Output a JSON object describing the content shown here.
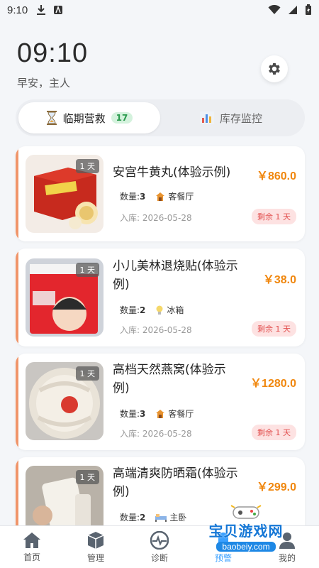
{
  "status_bar": {
    "time": "9:10"
  },
  "header": {
    "clock": "09:10",
    "greeting": "早安，主人"
  },
  "tabs": [
    {
      "label": "临期营救",
      "count": "17"
    },
    {
      "label": "库存监控"
    }
  ],
  "items": [
    {
      "name": "安宫牛黄丸(体验示例)",
      "price": "￥860.0",
      "qty_label": "数量:",
      "qty": "3",
      "location": "客餐厅",
      "location_icon": "house-icon",
      "date": "入库: 2026-05-28",
      "days": "1 天",
      "remaining": "剩余 1 天"
    },
    {
      "name": "小儿美林退烧贴(体验示例)",
      "price": "￥38.0",
      "qty_label": "数量:",
      "qty": "2",
      "location": "冰箱",
      "location_icon": "lightbulb-icon",
      "date": "入库: 2026-05-28",
      "days": "1 天",
      "remaining": "剩余 1 天"
    },
    {
      "name": "高档天然燕窝(体验示例)",
      "price": "￥1280.0",
      "qty_label": "数量:",
      "qty": "3",
      "location": "客餐厅",
      "location_icon": "house-icon",
      "date": "入库: 2026-05-28",
      "days": "1 天",
      "remaining": "剩余 1 天"
    },
    {
      "name": "高端清爽防晒霜(体验示例)",
      "price": "￥299.0",
      "qty_label": "数量:",
      "qty": "2",
      "location": "主卧",
      "location_icon": "bed-icon",
      "days": "1 天"
    }
  ],
  "nav": [
    {
      "label": "首页",
      "icon": "home-icon"
    },
    {
      "label": "管理",
      "icon": "box-icon"
    },
    {
      "label": "诊断",
      "icon": "pulse-icon"
    },
    {
      "label": "预警",
      "icon": "bell-icon"
    },
    {
      "label": "我的",
      "icon": "user-icon"
    }
  ],
  "watermark": {
    "title": "宝贝游戏网",
    "url": "baobeiy.com"
  },
  "colors": {
    "accent_orange": "#f0870e",
    "card_accent": "#f0956a",
    "remain_red": "#e2504f",
    "badge_green": "#2a9a4d",
    "nav_active": "#3aa0ff"
  }
}
